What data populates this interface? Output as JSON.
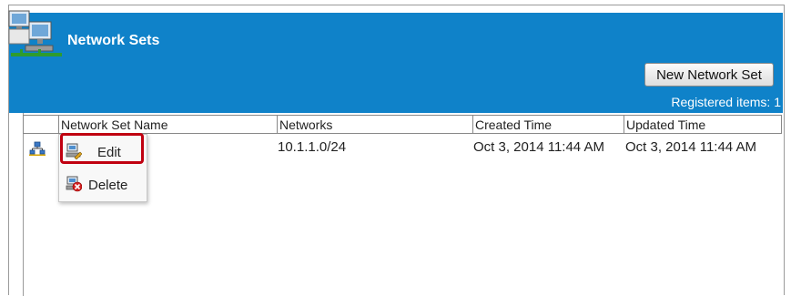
{
  "header": {
    "title": "Network Sets",
    "new_button": "New Network Set",
    "registered": "Registered items: 1",
    "accent": "#0f82c9"
  },
  "table": {
    "columns": [
      "Network Set Name",
      "Networks",
      "Created Time",
      "Updated Time"
    ],
    "rows": [
      {
        "name": "",
        "networks": "10.1.1.0/24",
        "created": "Oct 3, 2014 11:44 AM",
        "updated": "Oct 3, 2014 11:44 AM"
      }
    ]
  },
  "context_menu": {
    "items": [
      {
        "label": "Edit",
        "icon": "edit-network-icon",
        "highlighted": true
      },
      {
        "label": "Delete",
        "icon": "delete-network-icon"
      }
    ]
  }
}
